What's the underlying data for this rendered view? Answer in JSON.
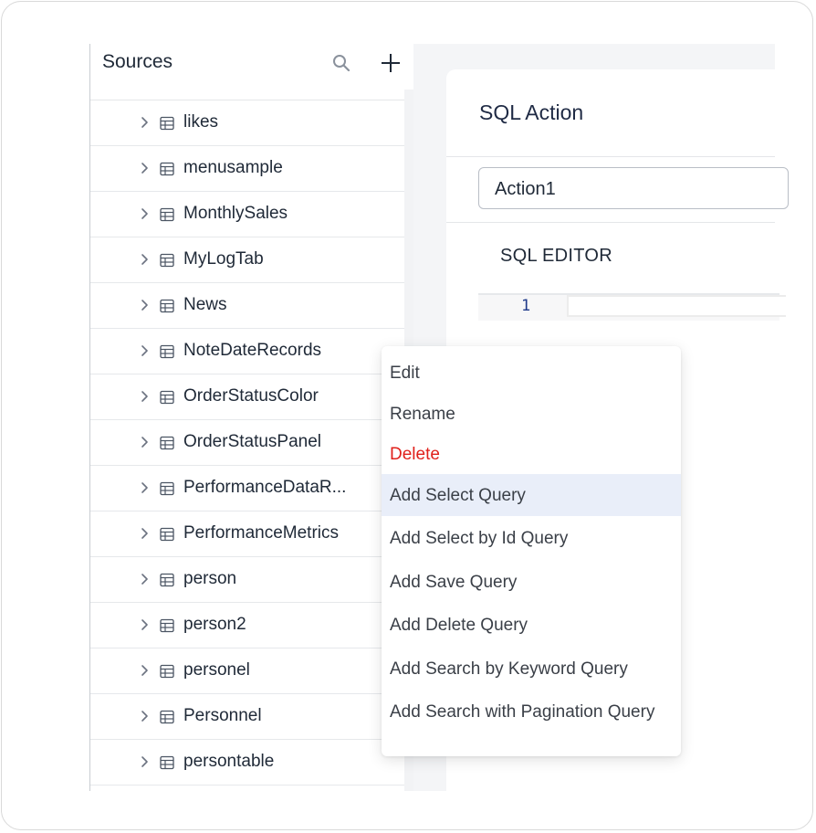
{
  "sidebar": {
    "title": "Sources",
    "items": [
      {
        "label": "likes"
      },
      {
        "label": "menusample"
      },
      {
        "label": "MonthlySales"
      },
      {
        "label": "MyLogTab"
      },
      {
        "label": "News"
      },
      {
        "label": "NoteDateRecords"
      },
      {
        "label": "OrderStatusColor"
      },
      {
        "label": "OrderStatusPanel"
      },
      {
        "label": "PerformanceDataR..."
      },
      {
        "label": "PerformanceMetrics"
      },
      {
        "label": "person"
      },
      {
        "label": "person2"
      },
      {
        "label": "personel"
      },
      {
        "label": "Personnel"
      },
      {
        "label": "persontable"
      }
    ]
  },
  "main": {
    "title": "SQL Action",
    "action_select_value": "Action1",
    "editor_title": "SQL EDITOR",
    "line_number": "1"
  },
  "context_menu": {
    "items": [
      {
        "label": "Edit",
        "state": "normal"
      },
      {
        "label": "Rename",
        "state": "normal"
      },
      {
        "label": "Delete",
        "state": "danger"
      },
      {
        "label": "Add Select Query",
        "state": "highlighted"
      },
      {
        "label": "Add Select by Id Query",
        "state": "normal"
      },
      {
        "label": "Add Save Query",
        "state": "normal"
      },
      {
        "label": "Add Delete Query",
        "state": "normal"
      },
      {
        "label": "Add Search by Keyword Query",
        "state": "normal"
      },
      {
        "label": "Add Search with Pagination Query",
        "state": "normal"
      }
    ]
  },
  "colors": {
    "danger": "#e0201b",
    "highlight": "#e9eef9",
    "panel_bg": "#f4f5f7"
  },
  "icons": {
    "search": "search-icon",
    "add": "plus-icon",
    "expand": "chevron-right-icon",
    "table": "table-icon"
  }
}
